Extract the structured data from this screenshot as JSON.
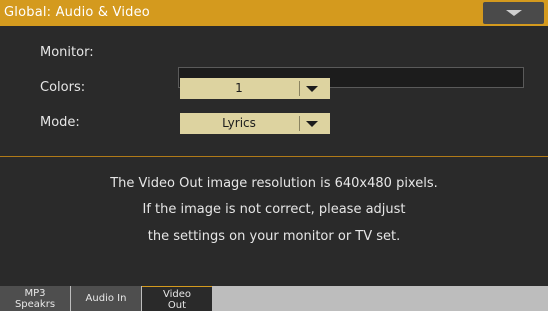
{
  "header": {
    "title": "Global: Audio & Video",
    "menu_icon": "chevron-down-icon"
  },
  "form": {
    "monitor_label": "Monitor:",
    "monitor_value": "",
    "colors_label": "Colors:",
    "colors_value": "1",
    "mode_label": "Mode:",
    "mode_value": "Lyrics"
  },
  "info": {
    "line1": "The Video Out image resolution is 640x480 pixels.",
    "line2": "If the image is not correct, please adjust",
    "line3": "the settings on your monitor or TV set."
  },
  "tabs": [
    {
      "line1": "MP3",
      "line2": "Speakrs",
      "active": false
    },
    {
      "line1": "Audio In",
      "line2": "",
      "active": false
    },
    {
      "line1": "Video",
      "line2": "Out",
      "active": true
    }
  ],
  "colors": {
    "accent": "#d49a1e",
    "combo_bg": "#ddd3a0",
    "panel_bg": "#2a2a2a"
  }
}
